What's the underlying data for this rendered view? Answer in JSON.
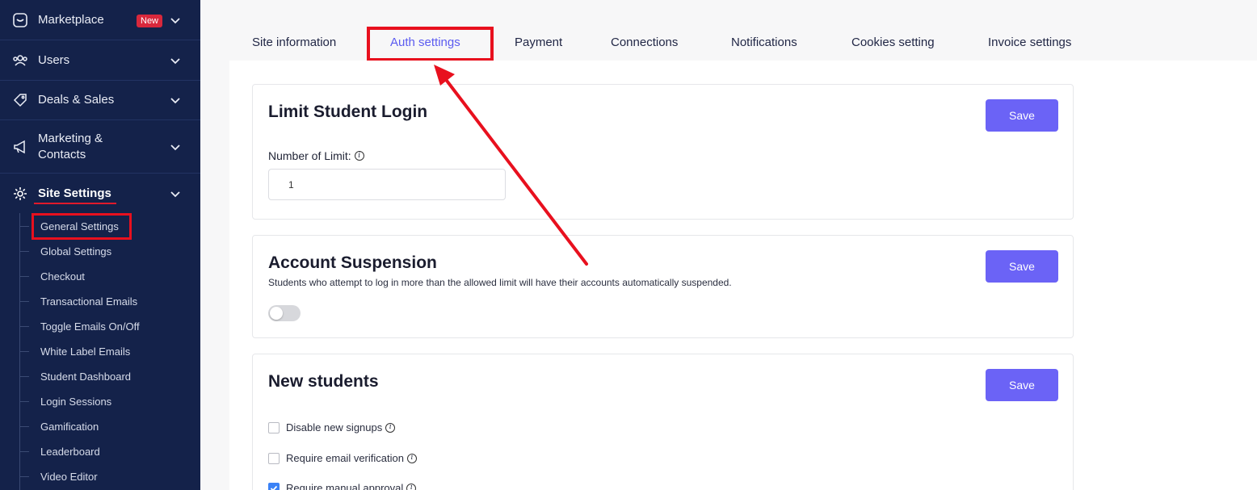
{
  "sidebar": {
    "items": [
      {
        "label": "Marketplace",
        "icon": "store-icon",
        "badge": "New"
      },
      {
        "label": "Users",
        "icon": "users-icon"
      },
      {
        "label": "Deals & Sales",
        "icon": "tag-icon"
      },
      {
        "label": "Marketing & Contacts",
        "icon": "megaphone-icon"
      },
      {
        "label": "Site Settings",
        "icon": "gear-icon",
        "active": true
      }
    ],
    "marketing_line1": "Marketing &",
    "marketing_line2": "Contacts",
    "sub_items": [
      "General Settings",
      "Global Settings",
      "Checkout",
      "Transactional Emails",
      "Toggle Emails On/Off",
      "White Label Emails",
      "Student Dashboard",
      "Login Sessions",
      "Gamification",
      "Leaderboard",
      "Video Editor"
    ]
  },
  "tabs": [
    "Site information",
    "Auth settings",
    "Payment",
    "Connections",
    "Notifications",
    "Cookies setting",
    "Invoice settings"
  ],
  "limit_card": {
    "title": "Limit Student Login",
    "save_label": "Save",
    "field_label": "Number of Limit:",
    "value": "1"
  },
  "suspension_card": {
    "title": "Account Suspension",
    "description": "Students who attempt to log in more than the allowed limit will have their accounts automatically suspended.",
    "save_label": "Save",
    "toggle_on": false
  },
  "new_students_card": {
    "title": "New students",
    "save_label": "Save",
    "options": [
      {
        "label": "Disable new signups",
        "checked": false
      },
      {
        "label": "Require email verification",
        "checked": false
      },
      {
        "label": "Require manual approval",
        "checked": true
      }
    ]
  },
  "colors": {
    "sidebar_bg": "#14224a",
    "accent": "#6b63f6",
    "active_tab": "#5b5bf0",
    "highlight": "#e8101e",
    "badge": "#d8283c"
  }
}
